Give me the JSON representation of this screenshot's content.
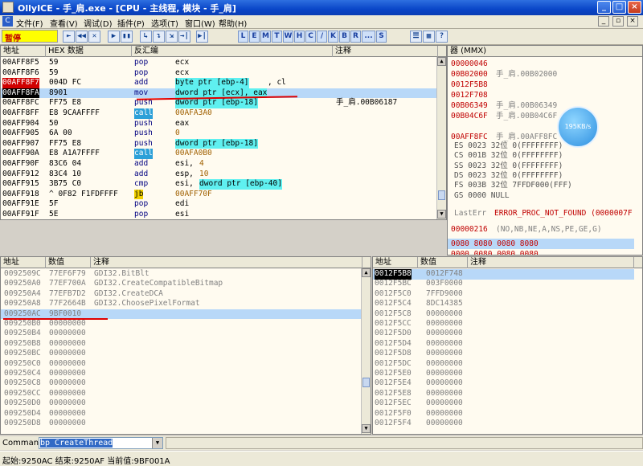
{
  "window": {
    "title": "OllyICE - 手_肩.exe - [CPU - 主线程, 模块 - 手_肩]",
    "min": "_",
    "max": "□",
    "close": "×"
  },
  "menu": [
    "文件(F)",
    "查看(V)",
    "调试(D)",
    "插件(P)",
    "选项(T)",
    "窗口(W)",
    "帮助(H)"
  ],
  "mdi": {
    "min": "_",
    "restore": "▫",
    "close": "×"
  },
  "toolbar": {
    "status": "暂停",
    "buttons": [
      "⇤",
      "◀◀",
      "✕",
      "▶",
      "▮▮",
      "↳",
      "↴",
      "⇲",
      "→|",
      "▶|"
    ],
    "letters": [
      "L",
      "E",
      "M",
      "T",
      "W",
      "H",
      "C",
      "/",
      "K",
      "B",
      "R",
      "...",
      "S"
    ],
    "extra": [
      "☰",
      "▦",
      "?"
    ]
  },
  "disasm": {
    "headers": [
      "地址",
      "HEX 数据",
      "反汇编",
      "注释"
    ],
    "rows": [
      {
        "addr": "00AFF8F5",
        "hex": "59",
        "mn": "pop",
        "arg": "ecx",
        "cm": ""
      },
      {
        "addr": "00AFF8F6",
        "hex": "59",
        "mn": "pop",
        "arg": "ecx",
        "cm": ""
      },
      {
        "addr": "00AFF8F7",
        "hex": "004D FC",
        "mn": "add",
        "argA": "byte ptr [ebp-4]",
        "argB": ", cl",
        "cm": ""
      },
      {
        "addr": "00AFF8FA",
        "hex": "8901",
        "mn": "mov",
        "arg": "dword ptr [ecx], eax",
        "cm": ""
      },
      {
        "addr": "00AFF8FC",
        "hex": "FF75 E8",
        "mn": "push",
        "argA": "dword ptr [ebp-18]",
        "argB": "",
        "cm": "手_肩.00B06187"
      },
      {
        "addr": "00AFF8FF",
        "hex": "E8 9CAAFFFF",
        "mn": "call",
        "arg": "00AFA3A0",
        "cm": ""
      },
      {
        "addr": "00AFF904",
        "hex": "50",
        "mn": "push",
        "arg": "eax",
        "cm": ""
      },
      {
        "addr": "00AFF905",
        "hex": "6A 00",
        "mn": "push",
        "arg": "0",
        "cm": ""
      },
      {
        "addr": "00AFF907",
        "hex": "FF75 E8",
        "mn": "push",
        "argA": "dword ptr [ebp-18]",
        "argB": "",
        "cm": ""
      },
      {
        "addr": "00AFF90A",
        "hex": "E8 A1A7FFFF",
        "mn": "call",
        "arg": "00AFA0B0",
        "cm": ""
      },
      {
        "addr": "00AFF90F",
        "hex": "83C6 04",
        "mn": "add",
        "argA": "esi, ",
        "argB": "4",
        "cm": ""
      },
      {
        "addr": "00AFF912",
        "hex": "83C4 10",
        "mn": "add",
        "argA": "esp, ",
        "argB": "10",
        "cm": ""
      },
      {
        "addr": "00AFF915",
        "hex": "3B75 C0",
        "mn": "cmp",
        "argA": "esi, ",
        "argB": "dword ptr [ebp-40]",
        "cm": ""
      },
      {
        "addr": "00AFF918",
        "hex": "^ 0F82 F1FDFFFF",
        "mn": "jb",
        "arg": "00AFF70F",
        "cm": ""
      },
      {
        "addr": "00AFF91E",
        "hex": "5F",
        "mn": "pop",
        "arg": "edi",
        "cm": ""
      },
      {
        "addr": "00AFF91F",
        "hex": "5E",
        "mn": "pop",
        "arg": "esi",
        "cm": ""
      }
    ]
  },
  "registers": {
    "header": "器 (MMX)",
    "lines": [
      {
        "v": "00000046",
        "c": ""
      },
      {
        "v": "00B02000",
        "c": "手_肩.00B02000"
      },
      {
        "v": "0012F5B8",
        "c": ""
      },
      {
        "v": "0012F708",
        "c": ""
      },
      {
        "v": "00B06349",
        "c": "手_肩.00B06349"
      },
      {
        "v": "00B04C6F",
        "c": "手_肩.00B04C6F"
      },
      {
        "v": "",
        "c": ""
      },
      {
        "v": "00AFF8FC",
        "c": "手_肩.00AFF8FC"
      }
    ],
    "segs": [
      "ES 0023 32位 0(FFFFFFFF)",
      "CS 001B 32位 0(FFFFFFFF)",
      "SS 0023 32位 0(FFFFFFFF)",
      "DS 0023 32位 0(FFFFFFFF)",
      "FS 003B 32位 7FFDF000(FFF)",
      "GS 0000 NULL"
    ],
    "lasterr_label": "LastErr",
    "lasterr_val": "ERROR_PROC_NOT_FOUND (0000007F",
    "eflags_v": "00000216",
    "eflags_c": "(NO,NB,NE,A,NS,PE,GE,G)",
    "mmx1": "0080 8080 0080 8080",
    "mmx2": "0000 0080 0080 0080",
    "speed": "195KB/s"
  },
  "dump": {
    "headers": [
      "地址",
      "数值",
      "注释"
    ],
    "rows": [
      {
        "a": "0092509C",
        "v": "77EF6F79",
        "c": "GDI32.BitBlt"
      },
      {
        "a": "009250A0",
        "v": "77EF700A",
        "c": "GDI32.CreateCompatibleBitmap"
      },
      {
        "a": "009250A4",
        "v": "77EFB7D2",
        "c": "GDI32.CreateDCA"
      },
      {
        "a": "009250A8",
        "v": "77F2664B",
        "c": "GDI32.ChoosePixelFormat"
      },
      {
        "a": "009250AC",
        "v": "9BF0010",
        "c": ""
      },
      {
        "a": "009250B0",
        "v": "00000000",
        "c": ""
      },
      {
        "a": "009250B4",
        "v": "00000000",
        "c": ""
      },
      {
        "a": "009250B8",
        "v": "00000000",
        "c": ""
      },
      {
        "a": "009250BC",
        "v": "00000000",
        "c": ""
      },
      {
        "a": "009250C0",
        "v": "00000000",
        "c": ""
      },
      {
        "a": "009250C4",
        "v": "00000000",
        "c": ""
      },
      {
        "a": "009250C8",
        "v": "00000000",
        "c": ""
      },
      {
        "a": "009250CC",
        "v": "00000000",
        "c": ""
      },
      {
        "a": "009250D0",
        "v": "00000000",
        "c": ""
      },
      {
        "a": "009250D4",
        "v": "00000000",
        "c": ""
      },
      {
        "a": "009250D8",
        "v": "00000000",
        "c": ""
      }
    ]
  },
  "stack": {
    "headers": [
      "地址",
      "数值",
      "注释"
    ],
    "rows": [
      {
        "a": "0012F5B8",
        "v": "0012F748"
      },
      {
        "a": "0012F5BC",
        "v": "003F0000"
      },
      {
        "a": "0012F5C0",
        "v": "7FFD9000"
      },
      {
        "a": "0012F5C4",
        "v": "8DC14385"
      },
      {
        "a": "0012F5C8",
        "v": "00000000"
      },
      {
        "a": "0012F5CC",
        "v": "00000000"
      },
      {
        "a": "0012F5D0",
        "v": "00000000"
      },
      {
        "a": "0012F5D4",
        "v": "00000000"
      },
      {
        "a": "0012F5D8",
        "v": "00000000"
      },
      {
        "a": "0012F5DC",
        "v": "00000000"
      },
      {
        "a": "0012F5E0",
        "v": "00000000"
      },
      {
        "a": "0012F5E4",
        "v": "00000000"
      },
      {
        "a": "0012F5E8",
        "v": "00000000"
      },
      {
        "a": "0012F5EC",
        "v": "00000000"
      },
      {
        "a": "0012F5F0",
        "v": "00000000"
      },
      {
        "a": "0012F5F4",
        "v": "00000000"
      }
    ]
  },
  "command": {
    "label": "Command",
    "value": "bp CreateThread",
    "drop": "▼"
  },
  "statusbar": "起始:9250AC  结束:9250AF  当前值:9BF001A"
}
